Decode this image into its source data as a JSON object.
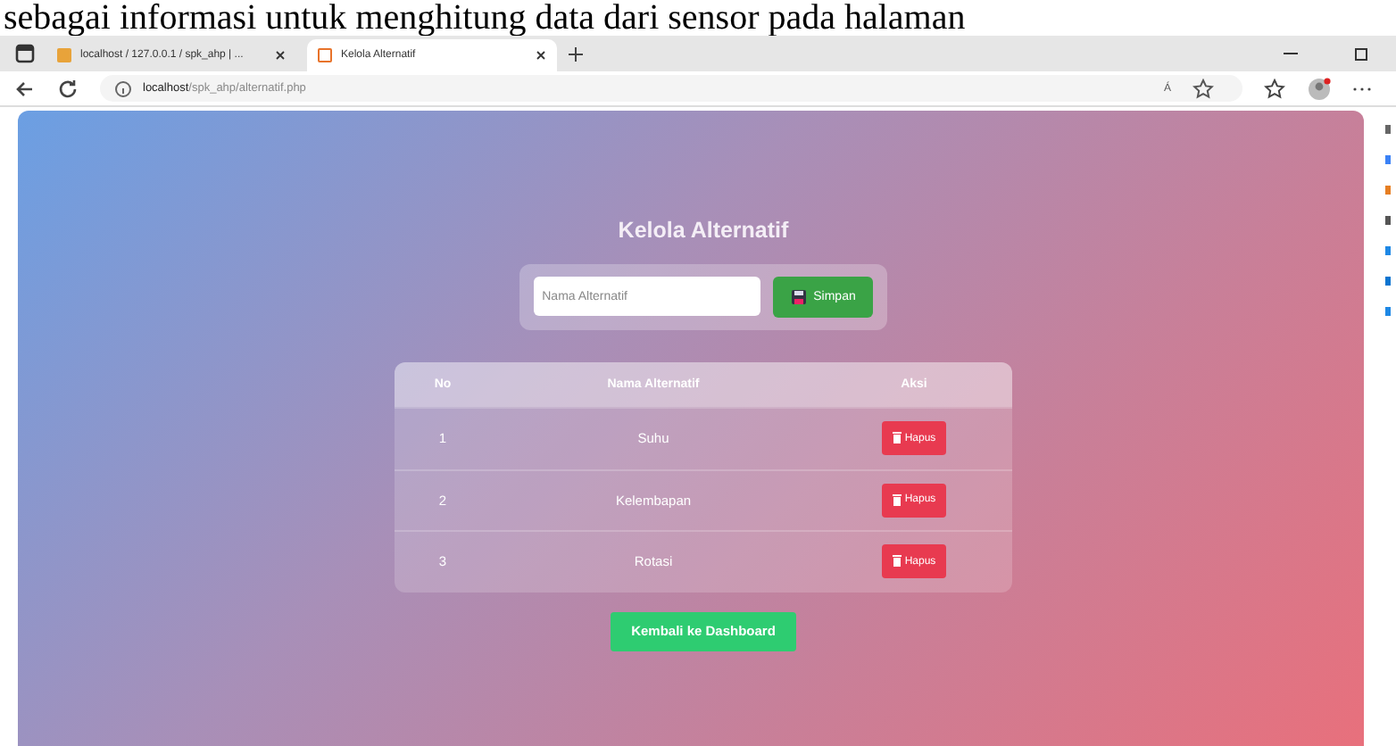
{
  "caption": "sebagai informasi untuk menghitung data dari sensor pada halaman",
  "tabs": [
    {
      "label": "localhost / 127.0.0.1 / spk_ahp | ...",
      "selected": false
    },
    {
      "label": "Kelola Alternatif",
      "selected": true
    }
  ],
  "address": {
    "host": "localhost",
    "path": "/spk_ahp/alternatif.php"
  },
  "reader_label": "Á",
  "page": {
    "title": "Kelola Alternatif",
    "input": {
      "placeholder": "Nama Alternatif"
    },
    "save_button": "Simpan",
    "table": {
      "columns": [
        "No",
        "Nama Alternatif",
        "Aksi"
      ],
      "rows": [
        {
          "no": "1",
          "name": "Suhu",
          "action": "Hapus"
        },
        {
          "no": "2",
          "name": "Kelembapan",
          "action": "Hapus"
        },
        {
          "no": "3",
          "name": "Rotasi",
          "action": "Hapus"
        }
      ]
    },
    "back_button": "Kembali ke Dashboard"
  }
}
